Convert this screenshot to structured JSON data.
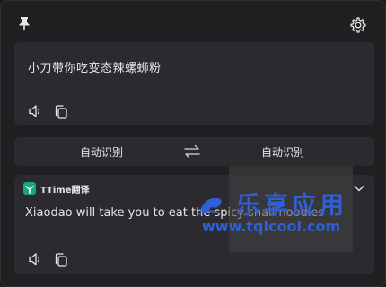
{
  "source": {
    "text": "小刀带你吃变态辣螺蛳粉"
  },
  "languages": {
    "from": "自动识别",
    "to": "自动识别"
  },
  "result": {
    "engine_name": "TTime翻译",
    "text": "Xiaodao will take you to eat the spicy snail noodles",
    "engine_color": "#1aa57a"
  },
  "watermark": {
    "title": "乐享应用",
    "url": "www.tqlcool.com",
    "color": "#2f5fd6"
  },
  "icons": {
    "pin": "pin-icon",
    "settings": "gear-icon",
    "speaker": "speaker-icon",
    "copy": "copy-icon",
    "swap": "swap-icon",
    "expand": "chevron-down-icon"
  }
}
